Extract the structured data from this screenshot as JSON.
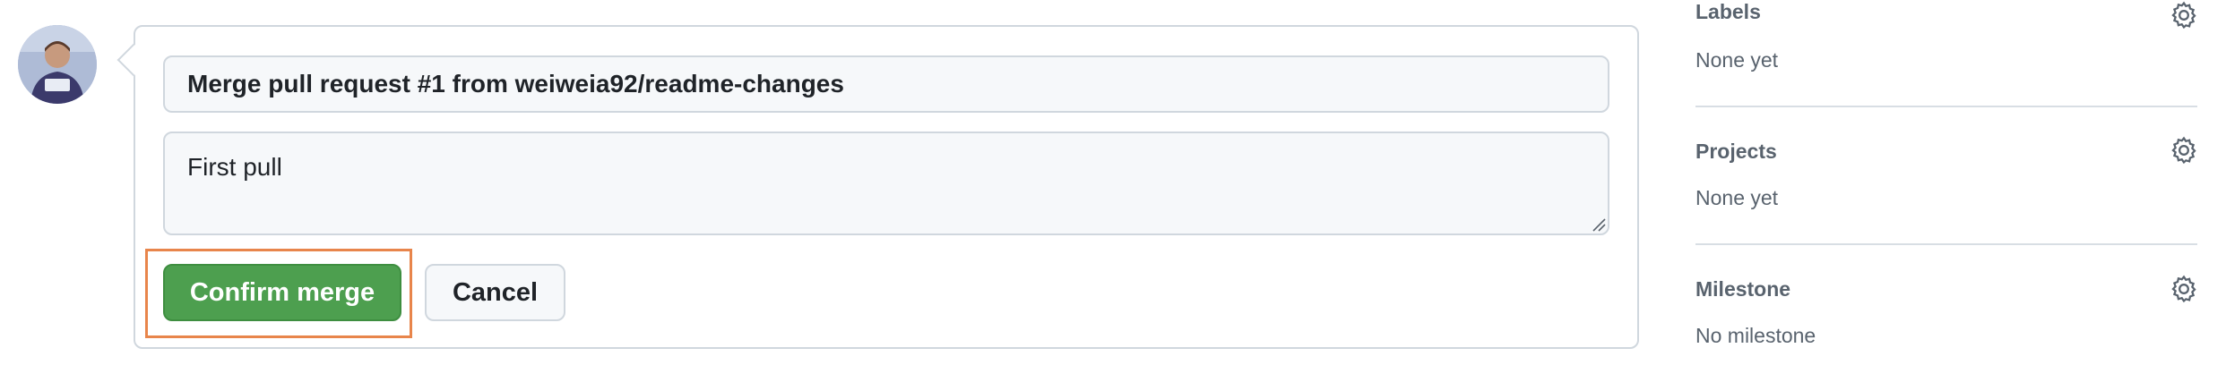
{
  "avatar": {
    "icon": "user-avatar"
  },
  "merge_form": {
    "commit_title": "Merge pull request #1 from weiweia92/readme-changes",
    "commit_message": "First pull",
    "confirm_label": "Confirm merge",
    "cancel_label": "Cancel",
    "confirm_color": "#4d9f4f",
    "highlight_color": "#e8854b"
  },
  "sidebar": {
    "sections": [
      {
        "heading": "Labels",
        "value": "None yet",
        "icon": "gear-icon"
      },
      {
        "heading": "Projects",
        "value": "None yet",
        "icon": "gear-icon"
      },
      {
        "heading": "Milestone",
        "value": "No milestone",
        "icon": "gear-icon"
      }
    ]
  }
}
